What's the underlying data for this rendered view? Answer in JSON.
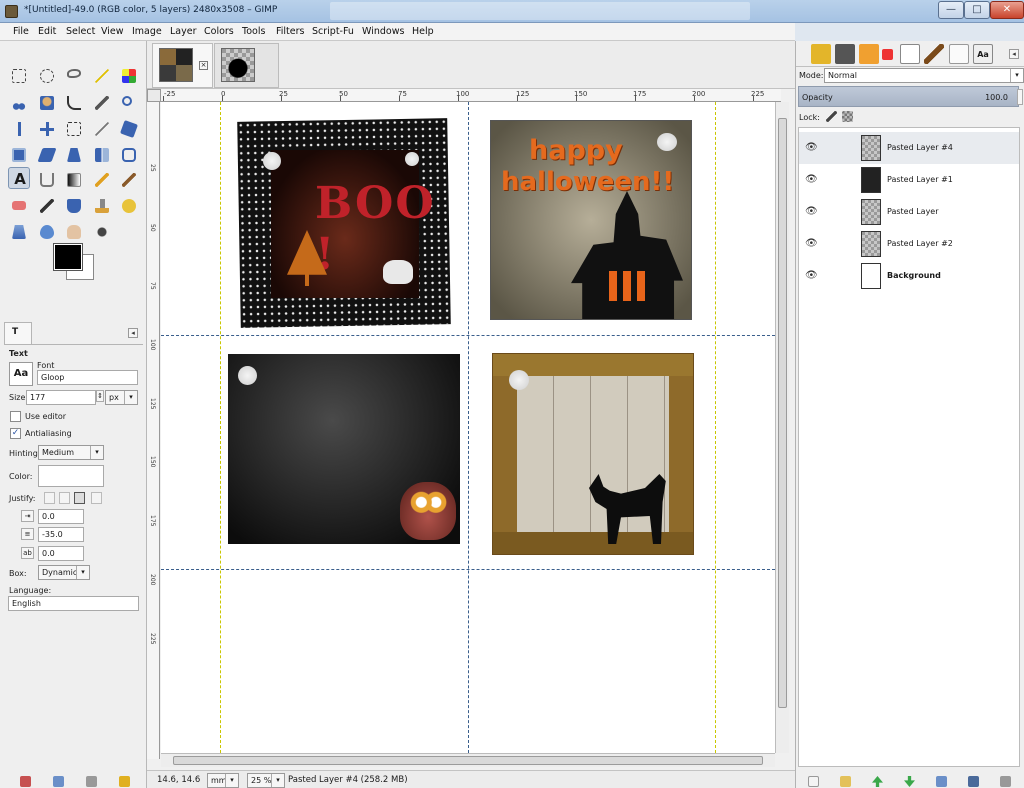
{
  "window": {
    "title": "*[Untitled]-49.0 (RGB color, 5 layers) 2480x3508 – GIMP",
    "min_glyph": "—",
    "max_glyph": "□",
    "close_glyph": "✕"
  },
  "menu": [
    "File",
    "Edit",
    "Select",
    "View",
    "Image",
    "Layer",
    "Colors",
    "Tools",
    "Filters",
    "Script-Fu",
    "Windows",
    "Help"
  ],
  "tool_options": {
    "heading": "Text",
    "font_label": "Font",
    "font_value": "Gloop",
    "font_preview": "Aa",
    "size_label": "Size:",
    "size_value": "177",
    "size_unit": "px",
    "use_editor_label": "Use editor",
    "antialiasing_label": "Antialiasing",
    "hinting_label": "Hinting:",
    "hinting_value": "Medium",
    "color_label": "Color:",
    "justify_label": "Justify:",
    "indent_value": "0.0",
    "line_spacing_value": "-35.0",
    "letter_spacing_value": "0.0",
    "box_label": "Box:",
    "box_value": "Dynamic",
    "language_label": "Language:",
    "language_value": "English"
  },
  "rulers": {
    "h_labels": [
      "-25",
      "0",
      "25",
      "50",
      "75",
      "100",
      "125",
      "150",
      "175",
      "200",
      "225"
    ],
    "v_labels": [
      "25",
      "50",
      "75",
      "100",
      "125",
      "150",
      "175",
      "200",
      "225"
    ]
  },
  "cards": {
    "boo_text": "BOO !",
    "hh_line1": "happy",
    "hh_line2": "halloween!!"
  },
  "statusbar": {
    "coords": "14.6, 14.6",
    "unit": "mm",
    "zoom": "25 %",
    "message": "Pasted Layer #4 (258.2 MB)"
  },
  "layers_dock": {
    "mode_label": "Mode:",
    "mode_value": "Normal",
    "opacity_label": "Opacity",
    "opacity_value": "100.0",
    "lock_label": "Lock:",
    "layers": [
      {
        "name": "Pasted Layer #4",
        "selected": true
      },
      {
        "name": "Pasted Layer #1",
        "selected": false
      },
      {
        "name": "Pasted Layer",
        "selected": false
      },
      {
        "name": "Pasted Layer #2",
        "selected": false
      },
      {
        "name": "Background",
        "selected": false
      }
    ]
  },
  "colors": {
    "accent": "#7d95b3",
    "guide": "#3a5e8c",
    "margin_guide": "#c9c700"
  }
}
